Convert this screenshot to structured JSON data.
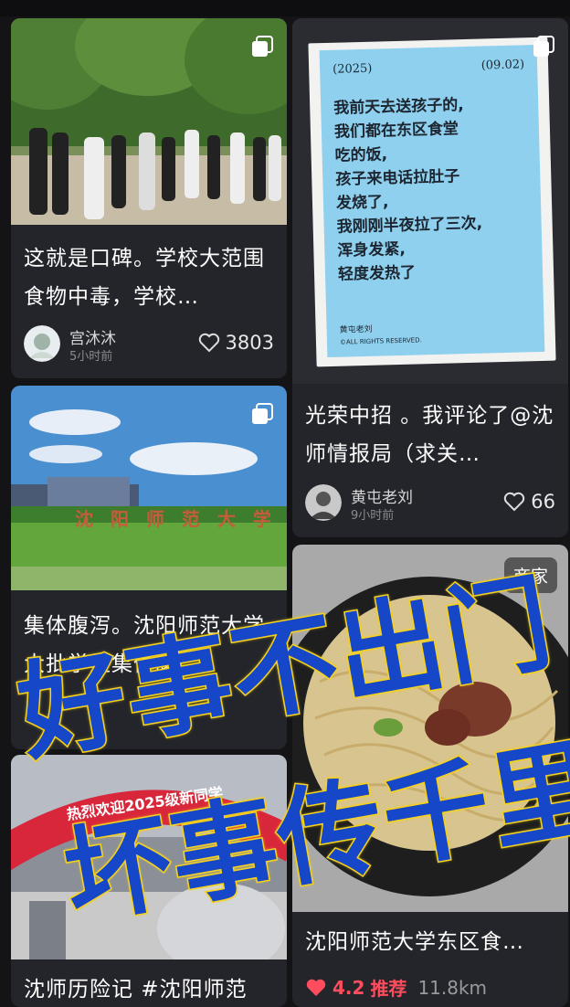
{
  "feed": {
    "cards": [
      {
        "title": "这就是口碑。学校大范围食物中毒，学校…",
        "author": "宫沐沐",
        "time": "5小时前",
        "likes": "3803",
        "icon": "multi-image-icon"
      },
      {
        "note": {
          "year": "(2025)",
          "date": "(09.02)",
          "lines": [
            "我前天去送孩子的,",
            "我们都在东区食堂",
            "吃的饭,",
            "孩子来电话拉肚子",
            "发烧了,",
            "我刚刚半夜拉了三次,",
            "浑身发紧,",
            "轻度发热了"
          ],
          "signature": "黄屯老刘",
          "rights": "©ALL RIGHTS RESERVED."
        },
        "title": "光荣中招 。我评论了@沈师情报局（求关…",
        "author": "黄屯老刘",
        "time": "9小时前",
        "likes": "66",
        "icon": "multi-image-icon"
      },
      {
        "campus_sign": "沈 阳 师 范 大 学",
        "title": "集体腹泻。沈阳师范大学大批学生集体腹…",
        "icon": "multi-image-icon"
      },
      {
        "badge": "商家",
        "title": "沈阳师范大学东区食…",
        "rating": "4.2",
        "recommend": "推荐",
        "distance": "11.8km"
      },
      {
        "banner": "热烈欢迎2025级新同学",
        "title": "沈师历险记 #沈阳师范"
      }
    ]
  },
  "overlay": {
    "line1": "好事不出门",
    "line2": "坏事传千里"
  },
  "colors": {
    "background": "#141416",
    "card": "#24252a",
    "overlay_text": "#1747c9",
    "overlay_outline": "#f6d21f",
    "rating_red": "#ff4d5e"
  }
}
